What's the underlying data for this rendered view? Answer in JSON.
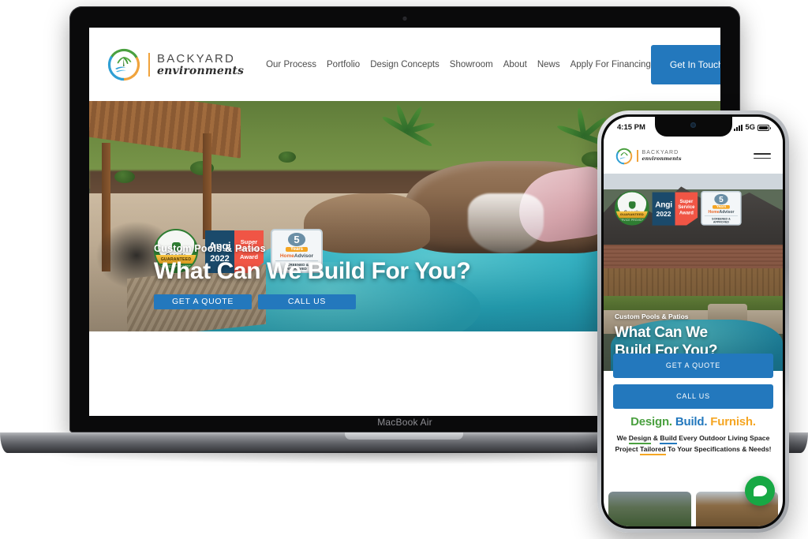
{
  "devices": {
    "laptop_label": "MacBook Air"
  },
  "site": {
    "brand": {
      "line1": "BACKYARD",
      "line2": "environments",
      "logo_icon": "palm-water-circle-logo"
    },
    "nav": {
      "items": [
        {
          "label": "Our Process"
        },
        {
          "label": "Portfolio"
        },
        {
          "label": "Design Concepts"
        },
        {
          "label": "Showroom"
        },
        {
          "label": "About"
        },
        {
          "label": "News"
        },
        {
          "label": "Apply For Financing"
        }
      ],
      "cta": "Get In Touch"
    },
    "hero": {
      "eyebrow": "Custom Pools & Patios",
      "headline": "What Can We Build For You?",
      "headline_line1": "What Can We",
      "headline_line2": "Build For You?",
      "primary_button": "GET A QUOTE",
      "secondary_button": "CALL US"
    },
    "badges": {
      "google": {
        "name": "Google",
        "band": "GUARANTEED",
        "sub": "SERVICE PROVIDER"
      },
      "angi": {
        "brand": "Angi",
        "year": "2022",
        "award_line1": "Super",
        "award_line2": "Service",
        "award_line3": "Award"
      },
      "homeadvisor": {
        "number": "5",
        "years": "Years",
        "brand_orange": "Home",
        "brand_dark": "Advisor",
        "check_line1": "SCREENED &",
        "check_line2": "APPROVED"
      }
    },
    "promo": {
      "word_design": "Design.",
      "word_build": "Build.",
      "word_furnish": "Furnish.",
      "sub_line1_a": "We ",
      "sub_line1_design": "Design",
      "sub_line1_b": " & ",
      "sub_line1_build": "Build",
      "sub_line1_c": " Every Outdoor Living Space",
      "sub_line2_a": "Project ",
      "sub_line2_tailored": "Tailored",
      "sub_line2_b": " To Your Specifications & Needs!"
    },
    "chat": {
      "icon": "chat-bubble-icon"
    }
  },
  "phone": {
    "status": {
      "time": "4:15 PM",
      "network": "5G",
      "signal_icon": "signal-bars-icon",
      "battery_icon": "battery-icon"
    },
    "menu_icon": "hamburger-menu-icon"
  },
  "colors": {
    "accent_blue": "#2378bd",
    "brand_green": "#4aa03f",
    "brand_orange": "#f5a623",
    "chat_green": "#17a844",
    "angi_navy": "#1b4a6b",
    "angi_red": "#f05545"
  }
}
